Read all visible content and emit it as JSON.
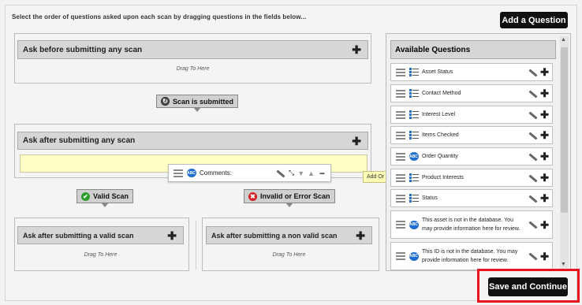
{
  "instruction": "Select the order of questions asked upon each scan by dragging questions in the fields below...",
  "add_question_button": "Add a Question",
  "save_button": "Save and Continue",
  "before": {
    "title": "Ask before submitting any scan",
    "drop": "Drag To Here"
  },
  "scan_submitted": "Scan is submitted",
  "after": {
    "title": "Ask after submitting any scan"
  },
  "floating_item": {
    "label": "Comments:"
  },
  "tooltip": "Add Or Remove Question",
  "valid_scan": "Valid Scan",
  "invalid_scan": "Invalid or Error Scan",
  "valid": {
    "title": "Ask after submitting a valid scan",
    "drop": "Drag To Here"
  },
  "invalid": {
    "title": "Ask after submitting a non valid scan",
    "drop": "Drag To Here"
  },
  "available": {
    "title": "Available Questions",
    "items": [
      {
        "label": "Asset Status",
        "icon": "list-icon"
      },
      {
        "label": "Contact Method",
        "icon": "list-icon"
      },
      {
        "label": "Interest Level",
        "icon": "list-icon"
      },
      {
        "label": "Items Checked",
        "icon": "checklist-icon"
      },
      {
        "label": "Order Quantity",
        "icon": "chat-bubble-icon"
      },
      {
        "label": "Product Interests",
        "icon": "checklist-icon"
      },
      {
        "label": "Status",
        "icon": "list-icon"
      },
      {
        "label": "This asset is not in the database. You may provide information here for review.",
        "icon": "chat-bubble-icon"
      },
      {
        "label": "This ID is not in the database. You may provide information here for review.",
        "icon": "chat-bubble-icon"
      }
    ]
  },
  "colors": {
    "accent_black": "#111111",
    "highlight_red": "#e8141e",
    "valid_green": "#2a9d2a",
    "invalid_red": "#d42020",
    "chat_blue": "#1f6fd1"
  }
}
